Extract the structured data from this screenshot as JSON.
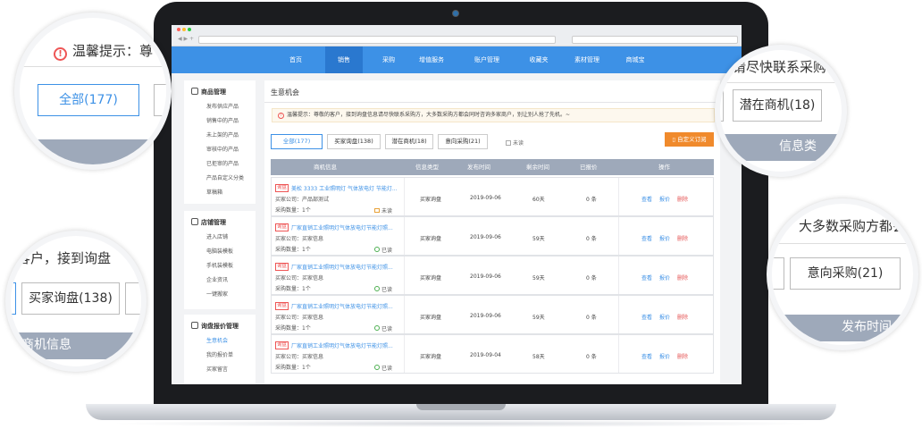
{
  "browser": {
    "nav_arrows": "◀ ▶ +"
  },
  "topnav": {
    "items": [
      {
        "label": "首页"
      },
      {
        "label": "销售",
        "active": true
      },
      {
        "label": "采购"
      },
      {
        "label": "增值服务"
      },
      {
        "label": "账户管理"
      },
      {
        "label": "收藏夹"
      },
      {
        "label": "素材管理"
      },
      {
        "label": "商城宝"
      }
    ]
  },
  "sidebar": {
    "sections": [
      {
        "title": "商品管理",
        "items": [
          "发布供应产品",
          "销售中的产品",
          "未上架的产品",
          "审核中的产品",
          "已拒审的产品",
          "产品自定义分类",
          "草稿箱"
        ]
      },
      {
        "title": "店铺管理",
        "items": [
          "进入店铺",
          "电脑装模板",
          "手机装模板",
          "企业资讯",
          "一键搬家"
        ]
      },
      {
        "title": "询盘报价管理",
        "items": [
          "生意机会",
          "我的报价单",
          "买家留言"
        ],
        "active_item": "生意机会"
      }
    ]
  },
  "main": {
    "title": "生意机会",
    "tip": "温馨提示：尊敬的客户，接到询盘信息请尽快联系采购方，大多数采购方都会同时咨询多家商户，别让别人抢了先机。~",
    "tabs": [
      "全部(177)",
      "买家询盘(138)",
      "潜在商机(18)",
      "意向采购(21)"
    ],
    "unread_label": "未读",
    "subscribe_button": "自定义订阅",
    "columns": [
      "商机信息",
      "信息类型",
      "发布时间",
      "剩余时间",
      "已报价",
      "操作"
    ],
    "rows": [
      {
        "tag": "询盘",
        "title": "美松 3333 工业照明灯 气体放电灯 节能灯...",
        "company": "买家公司：产品部测试",
        "qty": "采购数量：1个",
        "mark": "未读",
        "read": false,
        "type": "买家询盘",
        "date": "2019-09-06",
        "remain": "60天",
        "quoted": "0 条"
      },
      {
        "tag": "询盘",
        "title": "厂家直销工业照明灯气体放电灯节能灯照...",
        "company": "买家公司：买家信息",
        "qty": "采购数量：1个",
        "mark": "已读",
        "read": true,
        "type": "买家询盘",
        "date": "2019-09-06",
        "remain": "59天",
        "quoted": "0 条"
      },
      {
        "tag": "询盘",
        "title": "厂家直销工业照明灯气体放电灯节能灯照...",
        "company": "买家公司：买家信息",
        "qty": "采购数量：1个",
        "mark": "已读",
        "read": true,
        "type": "买家询盘",
        "date": "2019-09-06",
        "remain": "59天",
        "quoted": "0 条"
      },
      {
        "tag": "询盘",
        "title": "厂家直销工业照明灯气体放电灯节能灯照...",
        "company": "买家公司：买家信息",
        "qty": "采购数量：1个",
        "mark": "已读",
        "read": true,
        "type": "买家询盘",
        "date": "2019-09-06",
        "remain": "59天",
        "quoted": "0 条"
      },
      {
        "tag": "询盘",
        "title": "厂家直销工业照明灯气体放电灯节能灯照...",
        "company": "买家公司：买家信息",
        "qty": "采购数量：1个",
        "mark": "已读",
        "read": true,
        "type": "买家询盘",
        "date": "2019-09-04",
        "remain": "58天",
        "quoted": "0 条"
      }
    ],
    "actions": {
      "view": "查看",
      "quote": "报价",
      "delete": "删除"
    }
  },
  "zooms": {
    "top_left": {
      "tip": "温馨提示：尊",
      "tab": "全部(177)"
    },
    "mid_left": {
      "text": "的客户，接到询盘",
      "tab": "买家询盘(138)",
      "band": "商机信息"
    },
    "top_right": {
      "text": "请尽快联系采购",
      "tab": "潜在商机(18)",
      "band": "信息类"
    },
    "mid_right": {
      "text": "大多数采购方都会",
      "tab": "意向采购(21)",
      "band": "发布时间"
    }
  },
  "colors": {
    "primary": "#3d91e6",
    "header": "#9ea9ba",
    "accent": "#f08a2c",
    "alert": "#e55555"
  }
}
